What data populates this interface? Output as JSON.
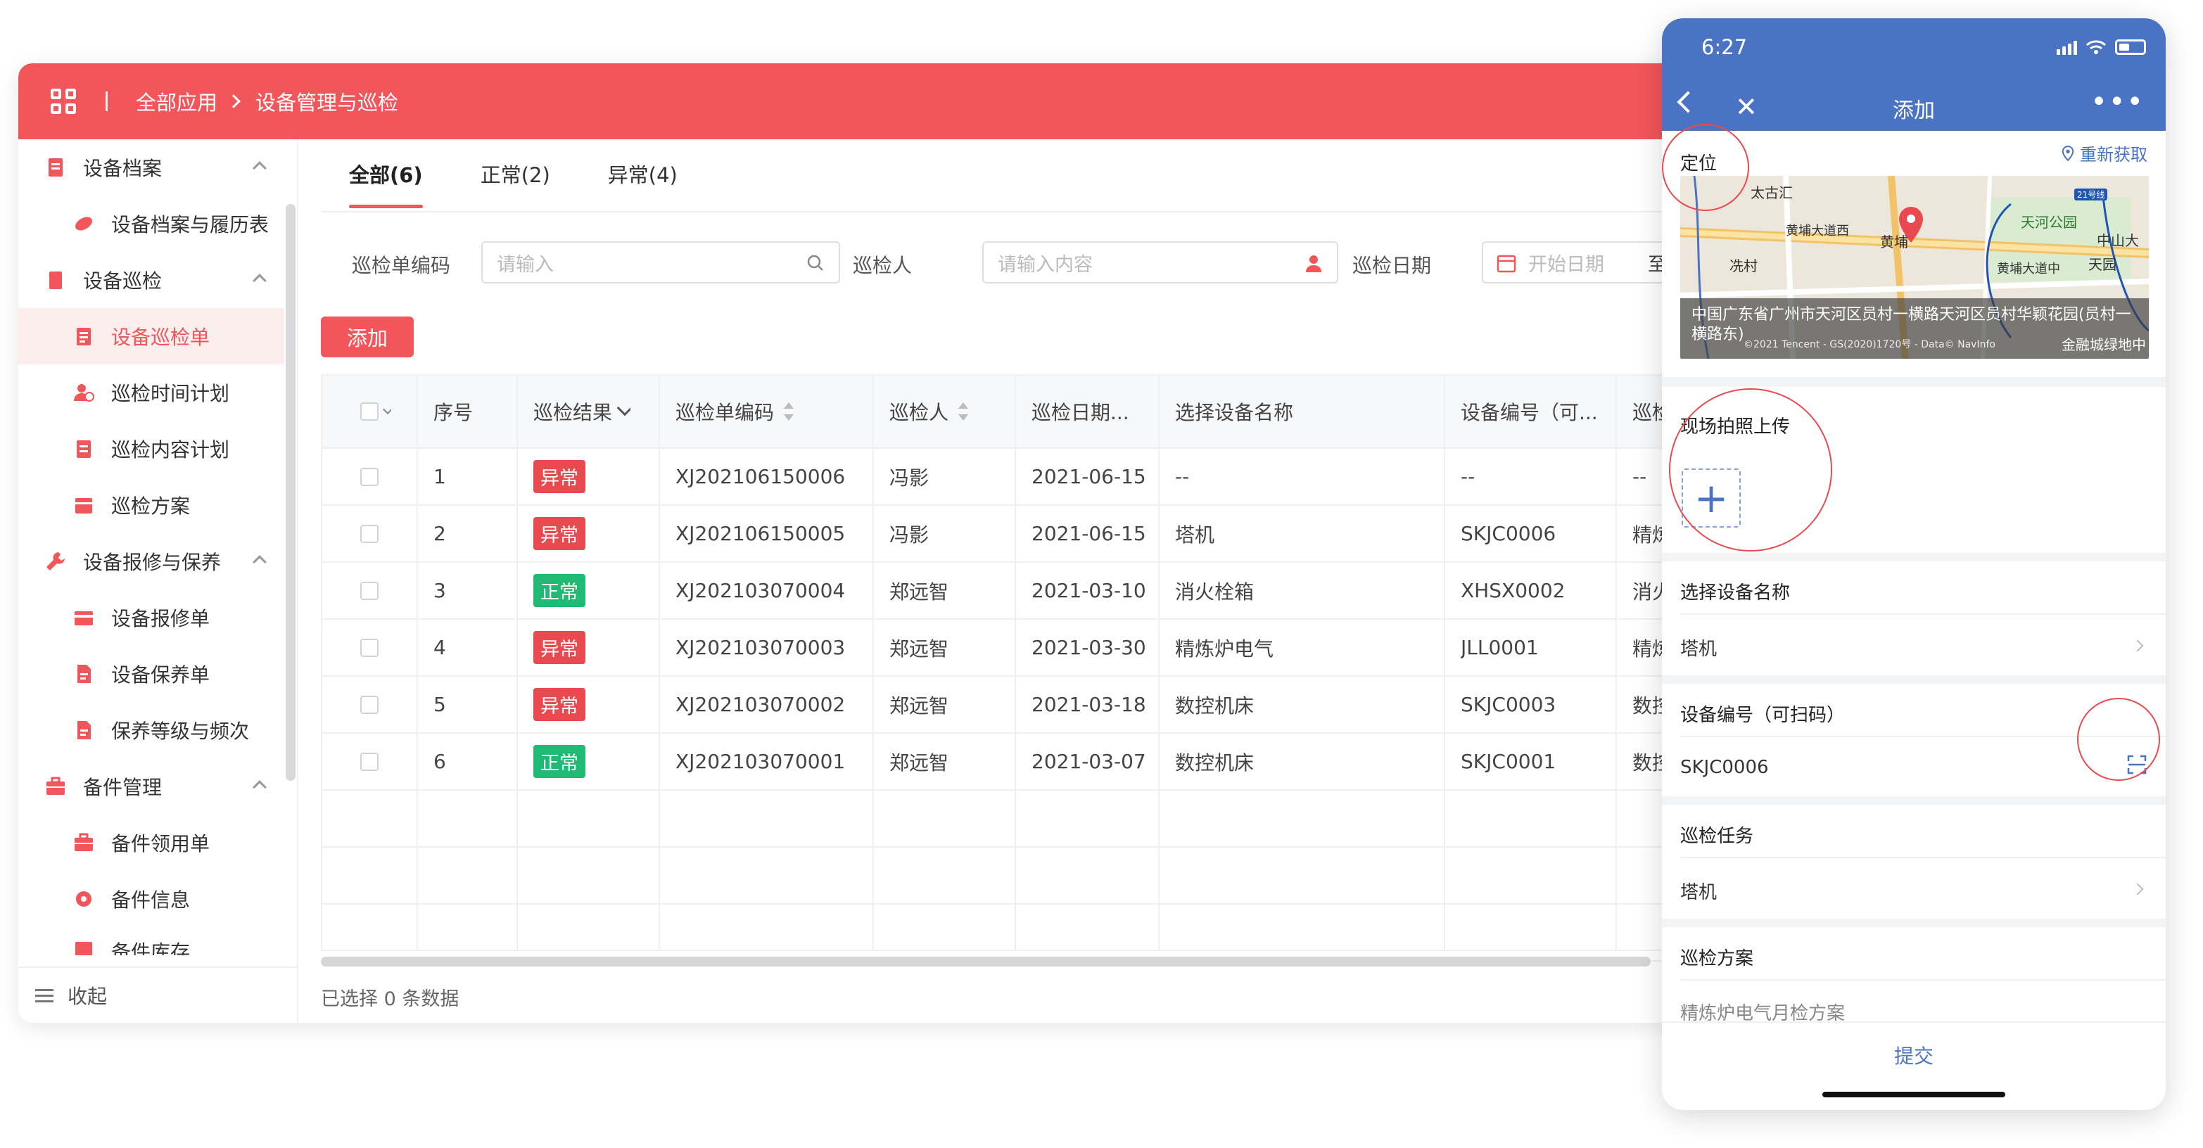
{
  "app": {
    "breadcrumb": [
      "全部应用",
      "设备管理与巡检"
    ]
  },
  "sidebar": {
    "items": [
      {
        "label": "设备档案",
        "level": "parent",
        "icon": "file-icon"
      },
      {
        "label": "设备档案与履历表",
        "level": "child",
        "icon": "leaf-icon"
      },
      {
        "label": "设备巡检",
        "level": "parent",
        "icon": "clipboard-icon"
      },
      {
        "label": "设备巡检单",
        "level": "child",
        "icon": "list-icon",
        "active": true
      },
      {
        "label": "巡检时间计划",
        "level": "child",
        "icon": "user-clock-icon"
      },
      {
        "label": "巡检内容计划",
        "level": "child",
        "icon": "doc-list-icon"
      },
      {
        "label": "巡检方案",
        "level": "child",
        "icon": "calendar-icon"
      },
      {
        "label": "设备报修与保养",
        "level": "parent",
        "icon": "wrench-icon"
      },
      {
        "label": "设备报修单",
        "level": "child",
        "icon": "card-icon"
      },
      {
        "label": "设备保养单",
        "level": "child",
        "icon": "doc-icon"
      },
      {
        "label": "保养等级与频次",
        "level": "child",
        "icon": "doc-icon"
      },
      {
        "label": "备件管理",
        "level": "parent",
        "icon": "briefcase-icon"
      },
      {
        "label": "备件领用单",
        "level": "child",
        "icon": "briefcase-icon"
      },
      {
        "label": "备件信息",
        "level": "child",
        "icon": "gear-icon"
      },
      {
        "label": "备件库存",
        "level": "child",
        "icon": "box-icon"
      }
    ],
    "collapse_label": "收起"
  },
  "tabs": [
    {
      "label": "全部(6)",
      "active": true
    },
    {
      "label": "正常(2)"
    },
    {
      "label": "异常(4)"
    }
  ],
  "filters": {
    "code_label": "巡检单编码",
    "code_placeholder": "请输入",
    "person_label": "巡检人",
    "person_placeholder": "请输入内容",
    "date_label": "巡检日期",
    "date_placeholder": "开始日期",
    "date_sep": "至"
  },
  "add_button": "添加",
  "table": {
    "headers": [
      "序号",
      "巡检结果",
      "巡检单编码",
      "巡检人",
      "巡检日期...",
      "选择设备名称",
      "设备编号（可...",
      "巡检"
    ],
    "rows": [
      {
        "no": "1",
        "result": "异常",
        "status": "err",
        "code": "XJ202106150006",
        "person": "冯影",
        "date": "2021-06-15",
        "device": "--",
        "device_no": "--",
        "task": "--"
      },
      {
        "no": "2",
        "result": "异常",
        "status": "err",
        "code": "XJ202106150005",
        "person": "冯影",
        "date": "2021-06-15",
        "device": "塔机",
        "device_no": "SKJC0006",
        "task": "精炼"
      },
      {
        "no": "3",
        "result": "正常",
        "status": "ok",
        "code": "XJ202103070004",
        "person": "郑远智",
        "date": "2021-03-10",
        "device": "消火栓箱",
        "device_no": "XHSX0002",
        "task": "消火"
      },
      {
        "no": "4",
        "result": "异常",
        "status": "err",
        "code": "XJ202103070003",
        "person": "郑远智",
        "date": "2021-03-30",
        "device": "精炼炉电气",
        "device_no": "JLL0001",
        "task": "精炼"
      },
      {
        "no": "5",
        "result": "异常",
        "status": "err",
        "code": "XJ202103070002",
        "person": "郑远智",
        "date": "2021-03-18",
        "device": "数控机床",
        "device_no": "SKJC0003",
        "task": "数控"
      },
      {
        "no": "6",
        "result": "正常",
        "status": "ok",
        "code": "XJ202103070001",
        "person": "郑远智",
        "date": "2021-03-07",
        "device": "数控机床",
        "device_no": "SKJC0001",
        "task": "数控"
      }
    ],
    "selected_note": "已选择 0 条数据"
  },
  "phone": {
    "time": "6:27",
    "title": "添加",
    "location_label": "定位",
    "refresh_label": "重新获取",
    "map_labels": [
      "太古汇",
      "黄埔大道西",
      "黄埔",
      "天河公园",
      "中山大",
      "天园",
      "冼村",
      "黄埔大道中",
      "21号线"
    ],
    "map_address": "中国广东省广州市天河区员村一横路天河区员村华颖花园(员村一横路东)",
    "map_credit": "©2021 Tencent - GS(2020)1720号 - Data© NavInfo",
    "map_brand": "金融城绿地中",
    "photo_label": "现场拍照上传",
    "device_name_label": "选择设备名称",
    "device_name_value": "塔机",
    "device_no_label": "设备编号（可扫码）",
    "device_no_value": "SKJC0006",
    "task_label": "巡检任务",
    "task_value": "塔机",
    "plan_label": "巡检方案",
    "plan_value": "精炼炉电气月检方案",
    "submit_label": "提交"
  },
  "colors": {
    "brand_red": "#f2555a",
    "phone_blue": "#4a73c4",
    "ok_green": "#21ba74",
    "err_red": "#e94a4f"
  }
}
